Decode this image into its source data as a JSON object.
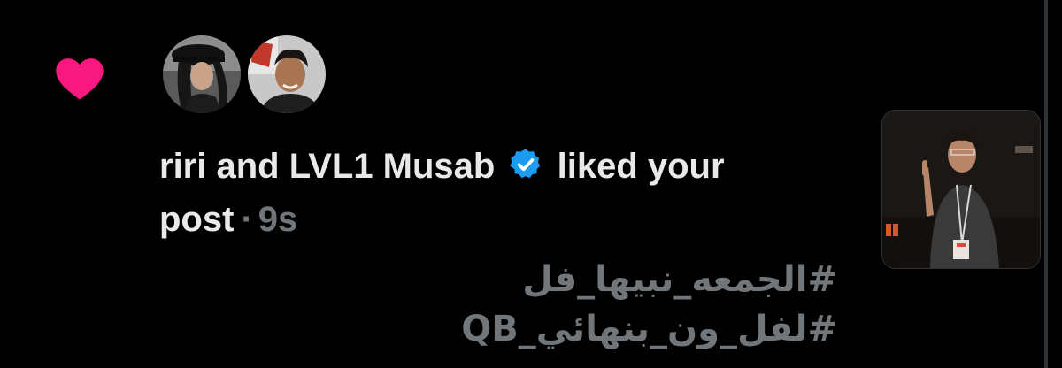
{
  "notification": {
    "type_icon": "heart-icon",
    "accent_color": "#f91880",
    "avatars": [
      {
        "icon": "avatar-user-1"
      },
      {
        "icon": "avatar-user-2"
      }
    ],
    "user1": "riri",
    "connector": "and",
    "user2": "LVL1 Musab",
    "verified_icon": "verified-badge-icon",
    "verified_color": "#1d9bf0",
    "action_text": "liked your post",
    "separator": "·",
    "time_ago": "9s"
  },
  "post": {
    "hashtags": [
      "#الجمعه_نبيها_فل",
      "#لفل_ون_بنهائي_QB"
    ],
    "thumbnail_icon": "post-thumbnail-image"
  }
}
